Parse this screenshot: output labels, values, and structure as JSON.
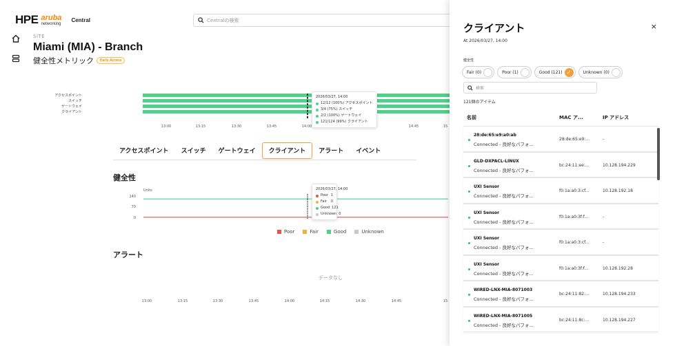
{
  "brand": {
    "hpe": "HPE",
    "aruba": "aruba",
    "networking": "networking",
    "product": "Central"
  },
  "search": {
    "placeholder": "Centralの検索"
  },
  "site": {
    "label": "SITE",
    "title": "Miami (MIA) - Branch",
    "subtitle": "健全性メトリック",
    "badge": "Early Access"
  },
  "strip": {
    "rows": [
      "アクセスポイント",
      "スイッチ",
      "ゲートウェイ",
      "クライアント"
    ],
    "tooltip": {
      "time": "2026/03/27, 14:00",
      "items": [
        "12/12 (100%) アクセスポイント",
        "3/4 (75%) スイッチ",
        "2/2 (100%) ゲートウェイ",
        "121/124 (99%) クライアント"
      ]
    },
    "ticks": [
      "13:00",
      "13:15",
      "13:30",
      "13:45",
      "14:00",
      "14:45",
      "15"
    ]
  },
  "tabs": [
    "アクセスポイント",
    "スイッチ",
    "ゲートウェイ",
    "クライアント",
    "アラート",
    "イベント"
  ],
  "active_tab_index": 3,
  "health": {
    "title": "健全性",
    "units_label": "Units",
    "y_ticks": [
      "140",
      "70",
      "0"
    ],
    "tooltip": {
      "time": "2026/03/27, 14:00",
      "rows": [
        {
          "name": "Poor",
          "value": "1"
        },
        {
          "name": "Fair",
          "value": "0"
        },
        {
          "name": "Good",
          "value": "121"
        },
        {
          "name": "Unknown",
          "value": "0"
        }
      ]
    },
    "legend": [
      "Poor",
      "Fair",
      "Good",
      "Unknown"
    ],
    "colors": {
      "Poor": "#e5534b",
      "Fair": "#f0b040",
      "Good": "#4fd18b",
      "Unknown": "#c8c8c8"
    }
  },
  "chart_data": {
    "type": "line",
    "series": [
      {
        "name": "Good",
        "values": [
          121,
          121,
          121,
          121,
          121
        ]
      },
      {
        "name": "Poor",
        "values": [
          1,
          1,
          1,
          1,
          1
        ]
      }
    ],
    "ylim": [
      0,
      140
    ]
  },
  "alerts": {
    "title": "アラート",
    "empty": "データなし"
  },
  "bottom_ticks": [
    "13:00",
    "13:15",
    "13:30",
    "13:45",
    "14:00",
    "14:15",
    "14:30",
    "14:45",
    "15"
  ],
  "panel": {
    "title": "クライアント",
    "close": "×",
    "at": "At 2026/03/27, 14:00",
    "health_label": "健全性",
    "filters": [
      {
        "label": "Fair (0)",
        "on": false
      },
      {
        "label": "Poor (1)",
        "on": false
      },
      {
        "label": "Good (121)",
        "on": true
      },
      {
        "label": "Unknown (0)",
        "on": false
      }
    ],
    "search_placeholder": "検索",
    "count": "121個のアイテム",
    "columns": [
      "名前",
      "MAC ア...",
      "IP アドレス"
    ],
    "rows": [
      {
        "name": "28:de:65:e9:a0:ab",
        "status": "Connected - 良好なパフォ...",
        "mac": "28:de:65:e9:...",
        "ip": "-"
      },
      {
        "name": "GLD-DXPACL-LINUX",
        "status": "Connected - 良好なパフォ...",
        "mac": "bc:24:11:ee:...",
        "ip": "10.128.194.229"
      },
      {
        "name": "UXI Sensor",
        "status": "Connected - 良好なパフォ...",
        "mac": "f0:1a:a0:3:cf...",
        "ip": "10.128.192.18"
      },
      {
        "name": "UXI Sensor",
        "status": "Connected - 良好なパフォ...",
        "mac": "f0:1a:a0:3f:f...",
        "ip": "-"
      },
      {
        "name": "UXI Sensor",
        "status": "Connected - 良好なパフォ...",
        "mac": "f0:1a:a0:3:cf...",
        "ip": "-"
      },
      {
        "name": "UXI Sensor",
        "status": "Connected - 良好なパフォ...",
        "mac": "f0:1a:a0:3f:f...",
        "ip": "10.128.192.28"
      },
      {
        "name": "WIRED-LNX-MIA-8071003",
        "status": "Connected - 良好なパフォ...",
        "mac": "bc:24:11:82:...",
        "ip": "10.128.194.233"
      },
      {
        "name": "WIRED-LNX-MIA-8071005",
        "status": "Connected - 良好なパフォ...",
        "mac": "bc:24:11:8c:...",
        "ip": "10.128.194.227"
      }
    ]
  }
}
